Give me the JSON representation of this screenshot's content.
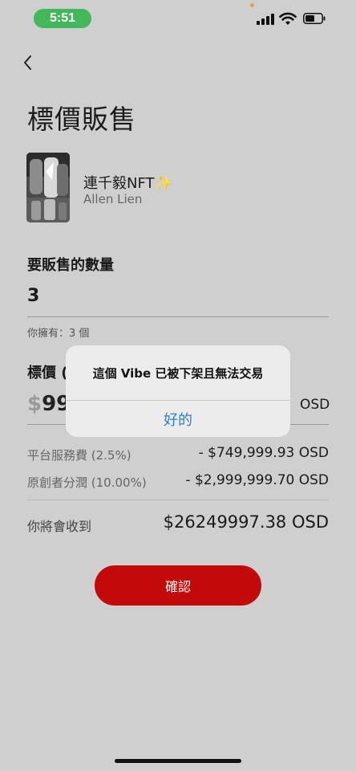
{
  "status_bar": {
    "time": "5:51"
  },
  "header": {
    "title": "標價販售"
  },
  "nft": {
    "name": "連千毅NFT✨",
    "creator": "Allen Lien"
  },
  "quantity": {
    "label": "要販售的數量",
    "value": "3",
    "owned_text": "你擁有：3 個"
  },
  "price": {
    "label": "標價 (",
    "value_prefix": "$",
    "value": "99",
    "unit": "OSD"
  },
  "fees": [
    {
      "label": "平台服務費 (2.5%)",
      "value": "- $749,999.93 OSD"
    },
    {
      "label": "原創者分潤 (10.00%)",
      "value": "- $2,999,999.70 OSD"
    }
  ],
  "receive": {
    "label": "你將會收到",
    "value": "$26249997.38 OSD"
  },
  "confirm_button": {
    "label": "確認"
  },
  "alert": {
    "message": "這個 Vibe 已被下架且無法交易",
    "ok_label": "好的"
  },
  "colors": {
    "background": "#cfcfcf",
    "confirm": "#c20a0a",
    "alert_link": "#2b7fd6",
    "time_pill": "#43b85a"
  }
}
